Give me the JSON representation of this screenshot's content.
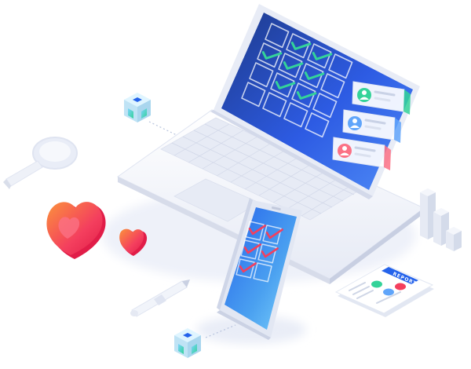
{
  "report": {
    "label": "REPORT"
  },
  "colors": {
    "screen_dark": "#1d3fb8",
    "screen_light": "#3b82f6",
    "check_green": "#34d399",
    "check_red": "#f43f5e",
    "heart_red": "#f43f5e",
    "heart_orange": "#fb923c",
    "body_white": "#f3f5fb"
  },
  "laptop_grid": {
    "rows": 4,
    "cols": 4,
    "checked_cells": [
      1,
      2,
      4,
      5,
      6,
      9,
      10
    ]
  },
  "phone_grid": {
    "rows": 3,
    "cols": 2,
    "checked_cells": [
      0,
      1,
      2,
      3,
      4
    ]
  },
  "profile_cards": [
    {
      "accent": "#34d399"
    },
    {
      "accent": "#60a5fa"
    },
    {
      "accent": "#fb7185"
    }
  ]
}
